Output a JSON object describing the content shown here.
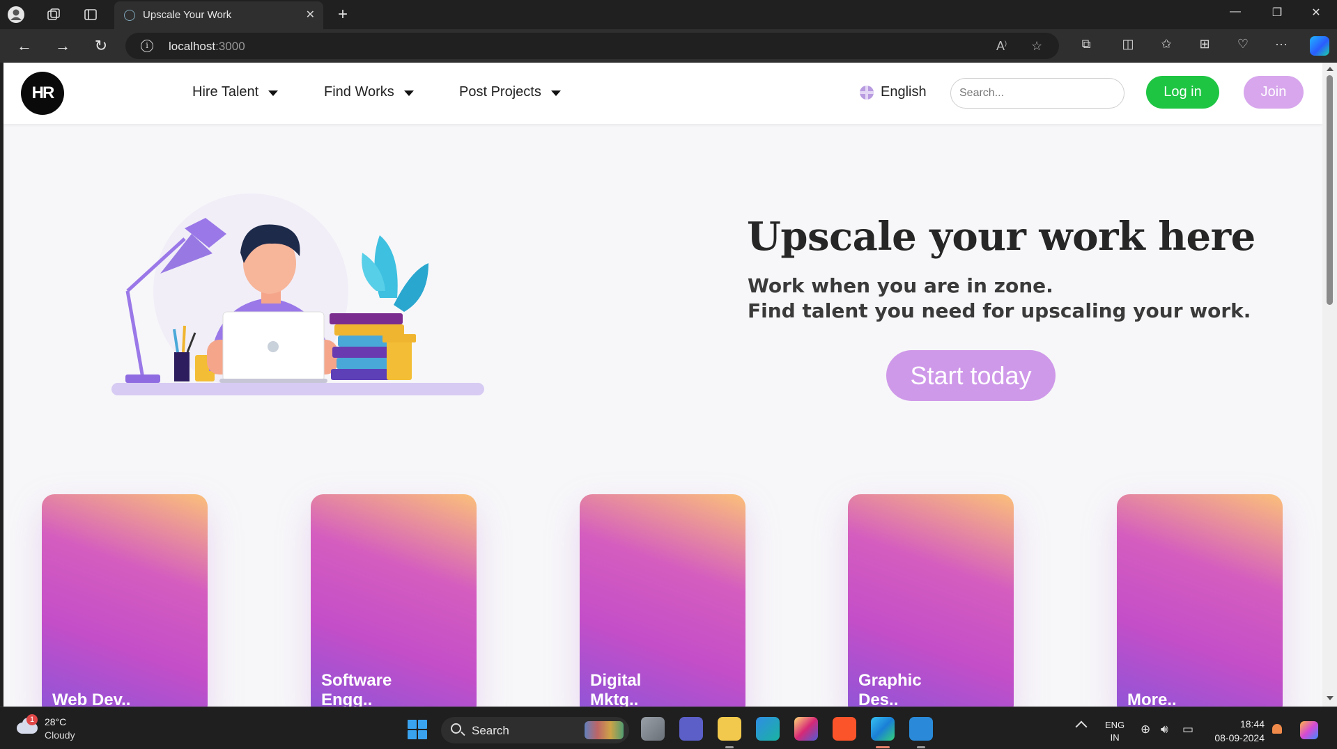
{
  "browser": {
    "tab_title": "Upscale Your Work",
    "url_host": "localhost",
    "url_port": ":3000",
    "icons": {
      "profile": "profile-icon",
      "workspaces": "workspaces-icon",
      "tab_actions": "tab-actions-icon",
      "close_tab": "close-icon",
      "new_tab": "plus-icon",
      "back": "back-arrow-icon",
      "forward": "forward-arrow-icon",
      "refresh": "refresh-icon",
      "site_info": "info-icon",
      "read_aloud": "read-aloud-icon",
      "favorite": "star-icon",
      "extensions": "puzzle-icon",
      "split_screen": "split-screen-icon",
      "favorites_list": "favorites-icon",
      "collections": "collections-icon",
      "browser_essentials": "heart-pulse-icon",
      "more": "more-icon",
      "copilot": "copilot-icon"
    }
  },
  "header": {
    "logo_text": "HR",
    "nav": [
      {
        "label": "Hire Talent"
      },
      {
        "label": "Find Works"
      },
      {
        "label": "Post Projects"
      }
    ],
    "language": "English",
    "search_placeholder": "Search...",
    "login_label": "Log in",
    "join_label": "Join"
  },
  "hero": {
    "title": "Upscale your work here",
    "subtitle_line1": "Work when you are in zone.",
    "subtitle_line2": "Find talent you need for upscaling your work.",
    "cta_label": "Start today"
  },
  "categories": [
    {
      "label": "Web Dev.."
    },
    {
      "label": "Software\nEngg.."
    },
    {
      "label": "Digital\nMktg.."
    },
    {
      "label": "Graphic\nDes.."
    },
    {
      "label": "More.."
    }
  ],
  "taskbar": {
    "weather_temp": "28°C",
    "weather_desc": "Cloudy",
    "weather_badge": "1",
    "search_label": "Search",
    "lang_line1": "ENG",
    "lang_line2": "IN",
    "time": "18:44",
    "date": "08-09-2024"
  },
  "colors": {
    "login_green": "#1ec543",
    "join_lilac": "#d7a6ec",
    "cta_lilac": "#cf99e9",
    "card_gradient_top": "#fbc07a",
    "card_gradient_mid": "#c44ec8",
    "card_gradient_bottom": "#8c55d8"
  }
}
